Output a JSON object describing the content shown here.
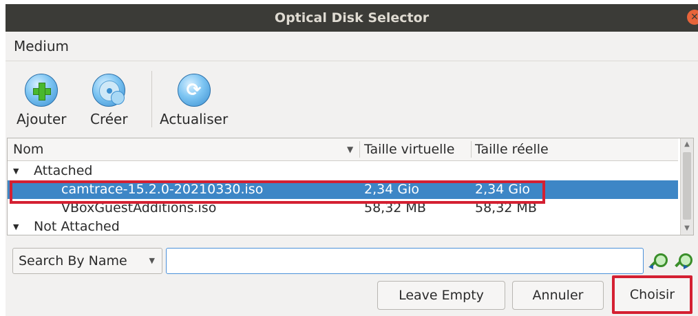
{
  "window": {
    "title": "Optical Disk Selector",
    "close_glyph": "✕"
  },
  "menu": {
    "medium": "Medium"
  },
  "toolbar": {
    "add_label": "Ajouter",
    "create_label": "Créer",
    "refresh_label": "Actualiser",
    "add_icon": "add-disk-icon",
    "create_icon": "create-disk-icon",
    "refresh_icon": "refresh-icon"
  },
  "table": {
    "columns": {
      "name": "Nom",
      "virtual_size": "Taille virtuelle",
      "actual_size": "Taille réelle"
    },
    "groups": [
      {
        "label": "Attached",
        "rows": [
          {
            "name": "camtrace-15.2.0-20210330.iso",
            "virtual_size": "2,34 Gio",
            "actual_size": "2,34 Gio",
            "selected": true
          },
          {
            "name": "VBoxGuestAdditions.iso",
            "virtual_size": "58,32 MB",
            "actual_size": "58,32 MB",
            "selected": false
          }
        ]
      },
      {
        "label": "Not Attached",
        "rows": []
      }
    ]
  },
  "search": {
    "mode": "Search By Name",
    "value": ""
  },
  "buttons": {
    "leave_empty": "Leave Empty",
    "cancel": "Annuler",
    "choose": "Choisir"
  },
  "colors": {
    "selection": "#3d86c6",
    "highlight": "#d42032",
    "titlebar": "#3b3b37"
  }
}
